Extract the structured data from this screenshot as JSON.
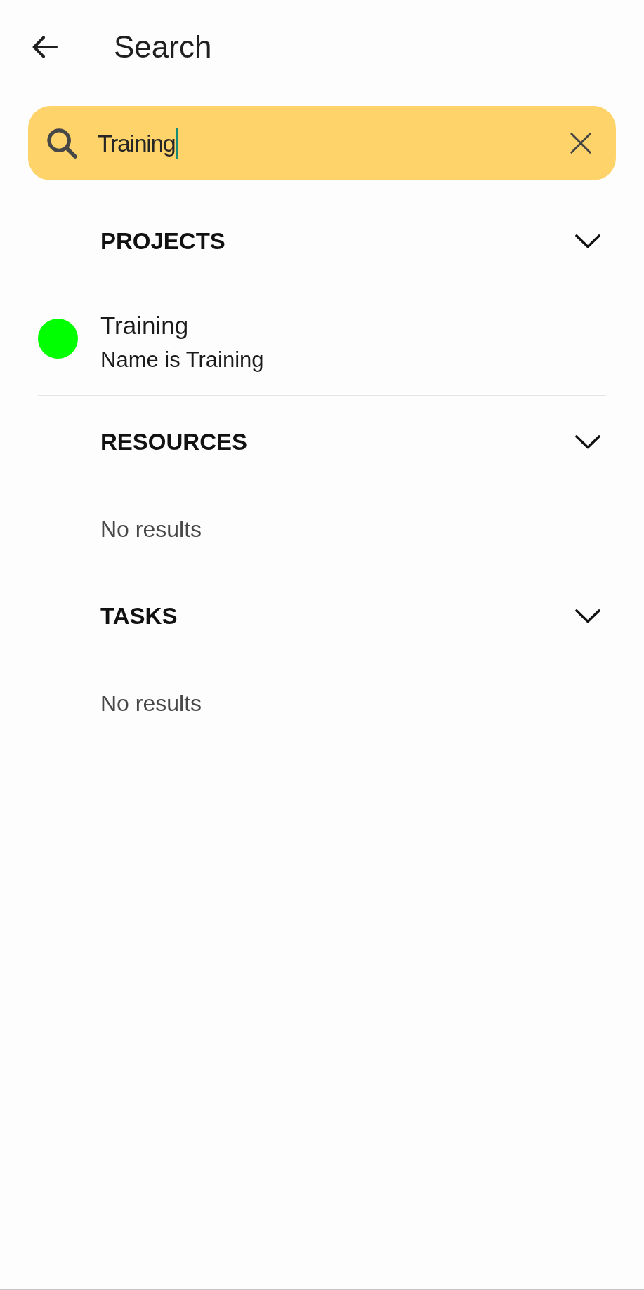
{
  "header": {
    "title": "Search"
  },
  "search": {
    "value": "Training",
    "focused": true
  },
  "sections": [
    {
      "title": "PROJECTS",
      "expanded": true,
      "results": [
        {
          "name": "Training",
          "detail": "Name is Training",
          "color": "#00ff00"
        }
      ]
    },
    {
      "title": "RESOURCES",
      "expanded": true,
      "empty_text": "No results"
    },
    {
      "title": "TASKS",
      "expanded": true,
      "empty_text": "No results"
    }
  ]
}
